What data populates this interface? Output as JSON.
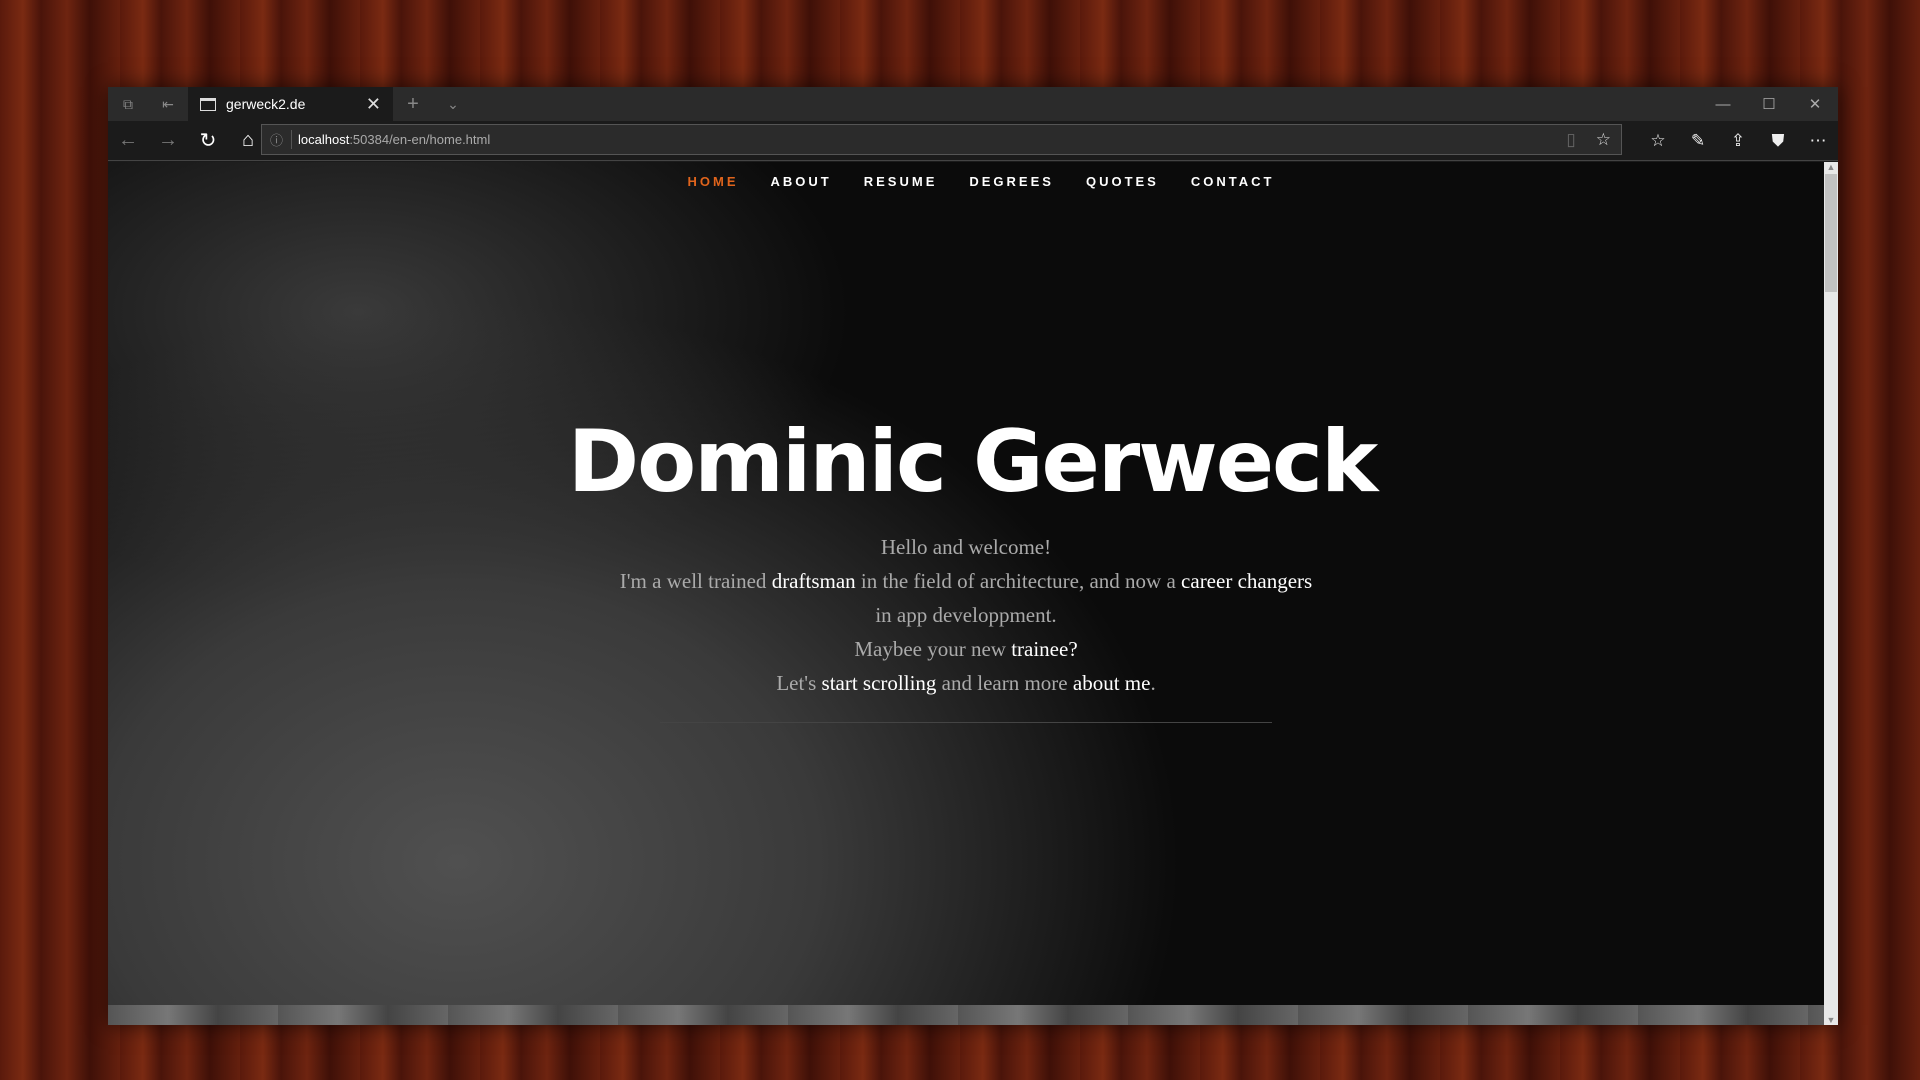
{
  "tab": {
    "title": "gerweck2.de"
  },
  "address": {
    "host": "localhost",
    "path": ":50384/en-en/home.html"
  },
  "nav": {
    "items": [
      "HOME",
      "ABOUT",
      "RESUME",
      "DEGREES",
      "QUOTES",
      "CONTACT"
    ],
    "active": "HOME"
  },
  "hero": {
    "title": "Dominic Gerweck",
    "line1": "Hello and welcome!",
    "l2a": "I'm a well trained ",
    "l2b": "draftsman",
    "l2c": " in the field of architecture, and now a ",
    "l2d": "career changers",
    "l2e": " in app developpment.",
    "l3a": "Maybee your new ",
    "l3b": "trainee?",
    "l4a": "Let's ",
    "l4b": "start scrolling",
    "l4c": " and learn more ",
    "l4d": "about me",
    "l4e": "."
  },
  "colors": {
    "accent": "#e0641c"
  }
}
